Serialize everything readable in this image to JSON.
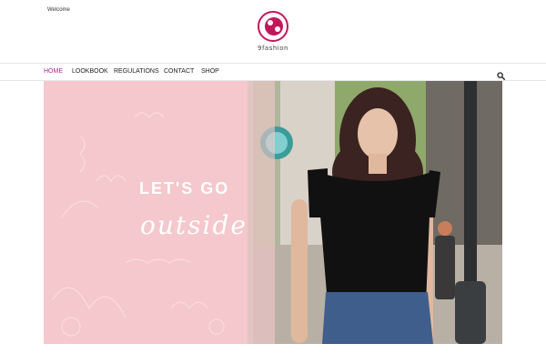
{
  "header": {
    "welcome": "Welcome",
    "logo_text": "9fashion",
    "logo_icon": "logo-icon"
  },
  "nav": {
    "items": [
      {
        "label": "HOME",
        "active": true
      },
      {
        "label": "LOOKBOOK",
        "active": false
      },
      {
        "label": "REGULATIONS",
        "active": false
      },
      {
        "label": "CONTACT",
        "active": false
      },
      {
        "label": "SHOP",
        "active": false
      }
    ],
    "search_icon": "search-icon",
    "active_color": "#b0248a"
  },
  "hero": {
    "line1": "LET'S GO",
    "line2": "outside",
    "panel_color": "#f4c8cc"
  }
}
